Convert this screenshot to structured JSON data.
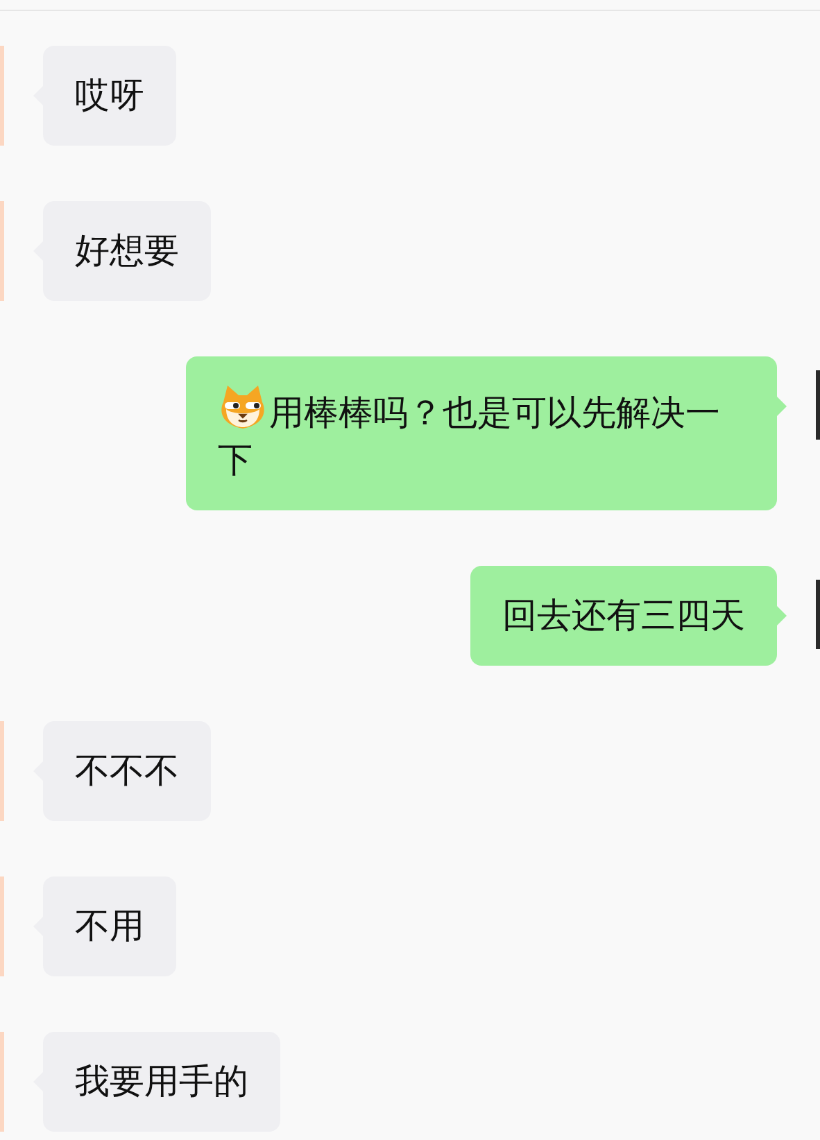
{
  "messages": [
    {
      "kind": "received",
      "text": "哎呀",
      "emoji": false
    },
    {
      "kind": "received",
      "text": "好想要",
      "emoji": false
    },
    {
      "kind": "sent",
      "text": "用棒棒吗？也是可以先解决一下",
      "emoji": true
    },
    {
      "kind": "sent",
      "text": "回去还有三四天",
      "emoji": false
    },
    {
      "kind": "received",
      "text": "不不不",
      "emoji": false
    },
    {
      "kind": "received",
      "text": "不用",
      "emoji": false
    },
    {
      "kind": "received",
      "text": "我要用手的",
      "emoji": false
    }
  ]
}
